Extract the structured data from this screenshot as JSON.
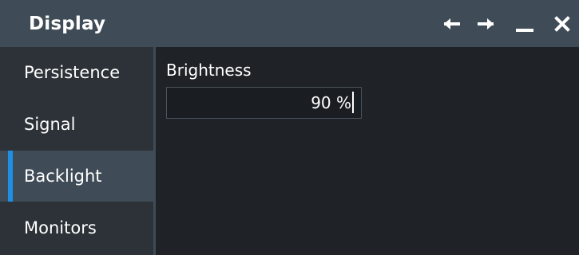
{
  "window": {
    "title": "Display"
  },
  "titlebar": {
    "buttons": [
      {
        "name": "back",
        "icon": "arrow-left-icon"
      },
      {
        "name": "forward",
        "icon": "arrow-right-icon"
      },
      {
        "name": "minimize",
        "icon": "minimize-icon"
      },
      {
        "name": "close",
        "icon": "close-icon"
      }
    ]
  },
  "sidebar": {
    "items": [
      {
        "label": "Persistence",
        "active": false
      },
      {
        "label": "Signal",
        "active": false
      },
      {
        "label": "Backlight",
        "active": true
      },
      {
        "label": "Monitors",
        "active": false
      }
    ]
  },
  "backlight": {
    "brightness": {
      "label": "Brightness",
      "value": "90 %",
      "numeric_value": 90,
      "unit": "%"
    }
  },
  "colors": {
    "titlebar_background": "#3f4b56",
    "sidebar_background": "#2c3238",
    "content_background": "#1f2327",
    "active_item_background": "#3f4b56",
    "active_item_accent": "#1f8fe5",
    "text": "#ffffff"
  }
}
